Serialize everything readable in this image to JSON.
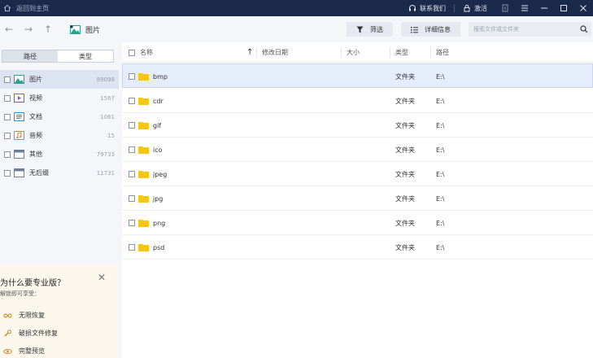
{
  "titlebar": {
    "home_label": "返回到主页",
    "contact_label": "联系我们",
    "activate_label": "激活"
  },
  "nav": {
    "breadcrumb": "图片",
    "filter_label": "筛选",
    "details_label": "详细信息",
    "search_placeholder": "搜索文件或文件夹"
  },
  "left": {
    "tabs": [
      {
        "label": "路径"
      },
      {
        "label": "类型"
      }
    ],
    "types": [
      {
        "label": "图片",
        "count": "89098",
        "icon": "image-type-icon",
        "color": "#27a38e"
      },
      {
        "label": "视频",
        "count": "1567",
        "icon": "video-type-icon",
        "color": "#8a56c4"
      },
      {
        "label": "文档",
        "count": "1061",
        "icon": "document-type-icon",
        "color": "#2a93c9"
      },
      {
        "label": "音频",
        "count": "15",
        "icon": "audio-type-icon",
        "color": "#d9823a"
      },
      {
        "label": "其他",
        "count": "79733",
        "icon": "other-type-icon",
        "color": "#6b7f99"
      },
      {
        "label": "无后缀",
        "count": "11731",
        "icon": "no-extension-type-icon",
        "color": "#6b7f99"
      }
    ]
  },
  "promo": {
    "title": "为什么要专业版？",
    "subtitle": "解锁即可享受：",
    "features": [
      {
        "label": "无限恢复",
        "icon": "infinity-icon"
      },
      {
        "label": "破损文件修复",
        "icon": "repair-icon"
      },
      {
        "label": "完整预览",
        "icon": "preview-eye-icon"
      }
    ]
  },
  "table": {
    "headers": {
      "name": "名称",
      "modified": "修改日期",
      "size": "大小",
      "type": "类型",
      "path": "路径"
    },
    "rows": [
      {
        "name": "bmp",
        "type": "文件夹",
        "path": "E:\\"
      },
      {
        "name": "cdr",
        "type": "文件夹",
        "path": "E:\\"
      },
      {
        "name": "gif",
        "type": "文件夹",
        "path": "E:\\"
      },
      {
        "name": "ico",
        "type": "文件夹",
        "path": "E:\\"
      },
      {
        "name": "jpeg",
        "type": "文件夹",
        "path": "E:\\"
      },
      {
        "name": "jpg",
        "type": "文件夹",
        "path": "E:\\"
      },
      {
        "name": "png",
        "type": "文件夹",
        "path": "E:\\"
      },
      {
        "name": "psd",
        "type": "文件夹",
        "path": "E:\\"
      }
    ]
  },
  "colors": {
    "titlebar_bg": "#1b2a4b",
    "selection_bg": "#e5ecfa",
    "folder_yellow": "#f5c518",
    "promo_bg": "#fbf7ec"
  }
}
